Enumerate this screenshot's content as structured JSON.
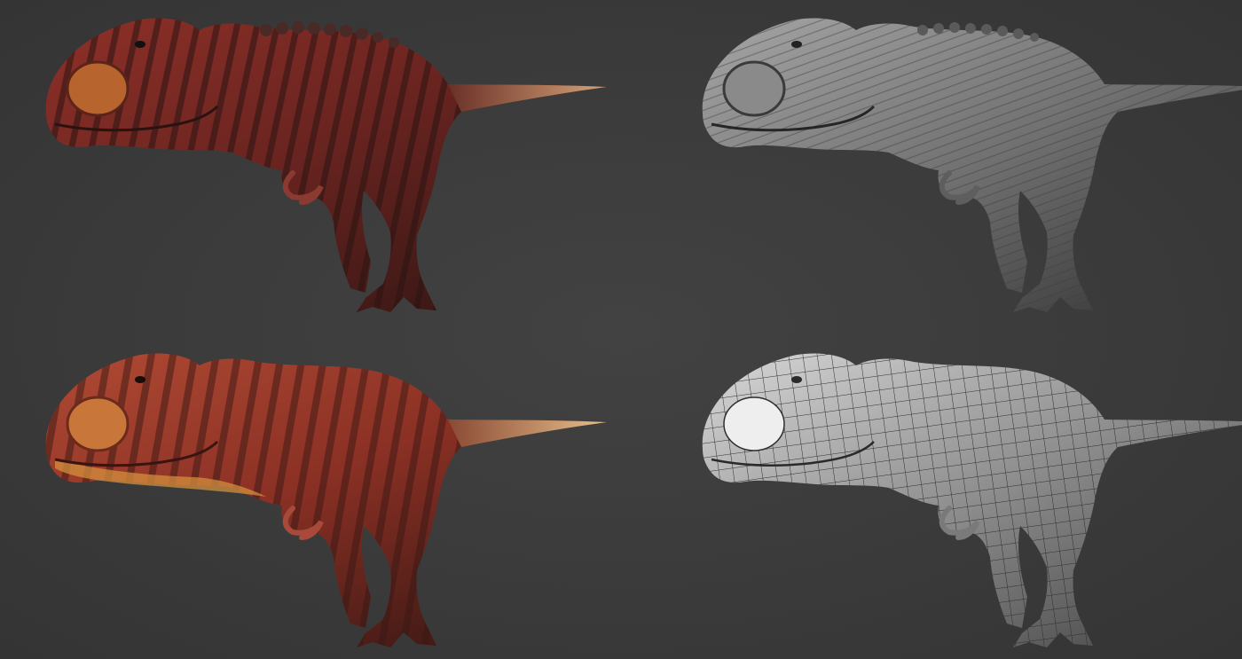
{
  "image": {
    "background_color": "#3b3b3b",
    "subject": "tyrannosaurus-3d-model",
    "panels": [
      {
        "position": "top-left",
        "render_style": "textured-detailed",
        "primary_color": "#7a2a22",
        "secondary_color": "#3a1a16",
        "tail_color": "#c08a5a"
      },
      {
        "position": "top-right",
        "render_style": "clay-sculpt-highpoly",
        "primary_color": "#8a8a8a",
        "secondary_color": "#4a4a4a",
        "tail_color": "#7a7a7a"
      },
      {
        "position": "bottom-left",
        "render_style": "textured-painted",
        "primary_color": "#9a3a2a",
        "secondary_color": "#4a2018",
        "tail_color": "#d8a878"
      },
      {
        "position": "bottom-right",
        "render_style": "wireframe-lowpoly",
        "primary_color": "#9c9c9c",
        "secondary_color": "#5a5a5a",
        "tail_color": "#8c8c8c"
      }
    ]
  }
}
